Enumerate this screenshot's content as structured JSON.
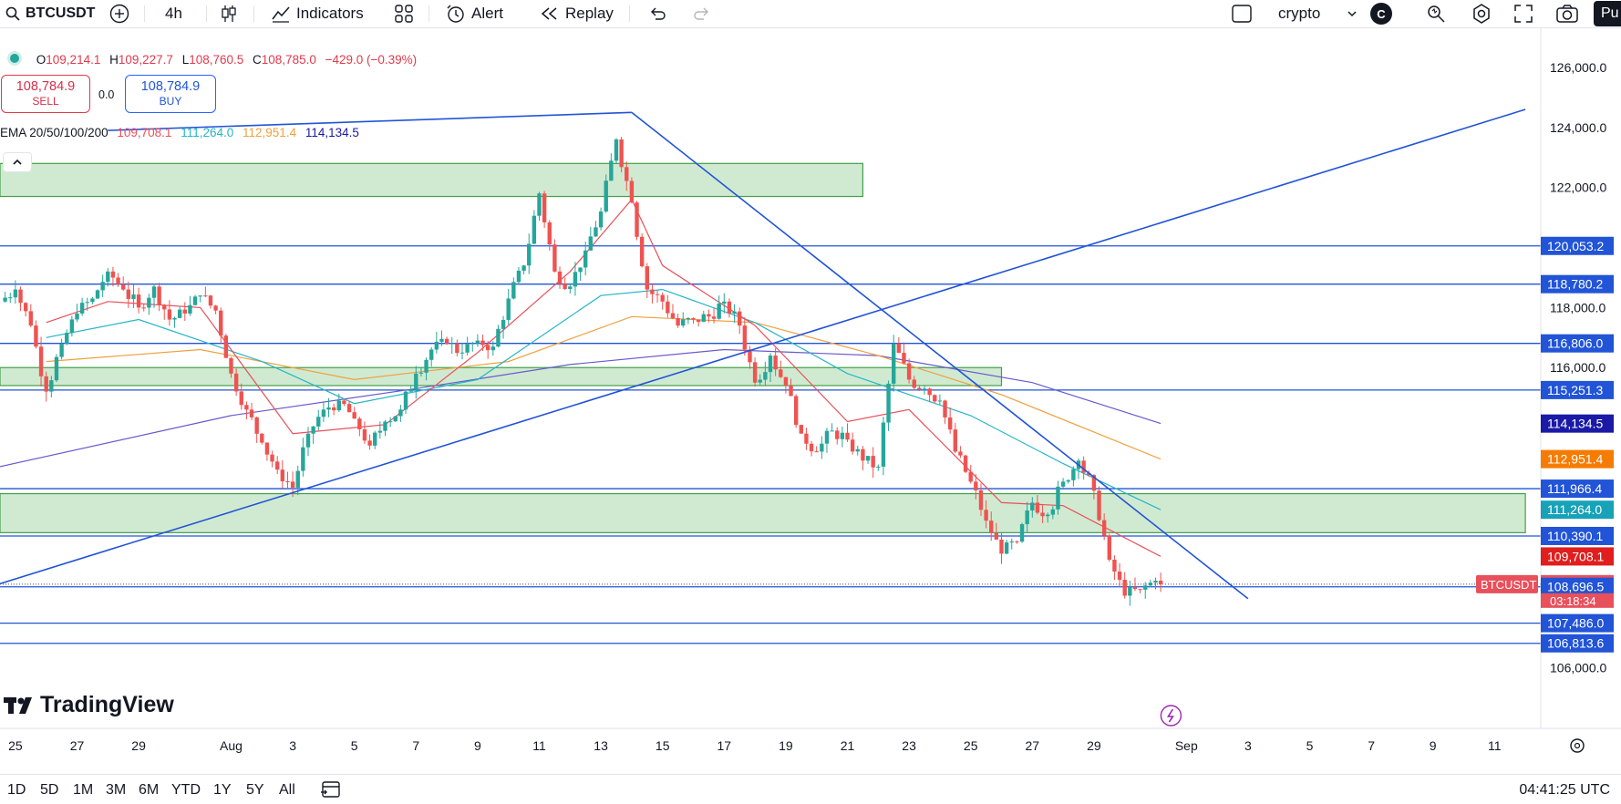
{
  "toolbar": {
    "symbol": "BTCUSDT",
    "interval": "4h",
    "indicators_label": "Indicators",
    "alert_label": "Alert",
    "replay_label": "Replay",
    "layout_name": "crypto",
    "account_initial": "C",
    "publish_label": "Pu"
  },
  "legend": {
    "o_label": "O",
    "o": "109,214.1",
    "h_label": "H",
    "h": "109,227.7",
    "l_label": "L",
    "l": "108,760.5",
    "c_label": "C",
    "c": "108,785.0",
    "change": "−429.0 (−0.39%)"
  },
  "trade": {
    "sell_price": "108,784.9",
    "sell_label": "SELL",
    "spread": "0.0",
    "buy_price": "108,784.9",
    "buy_label": "BUY"
  },
  "ema": {
    "label": "EMA 20/50/100/200",
    "v20": "109,708.1",
    "v50": "111,264.0",
    "v100": "112,951.4",
    "v200": "114,134.5"
  },
  "logo_text": "TradingView",
  "bottom": {
    "ranges": [
      "1D",
      "5D",
      "1M",
      "3M",
      "6M",
      "YTD",
      "1Y",
      "5Y",
      "All"
    ],
    "clock": "04:41:25 UTC"
  },
  "colors": {
    "up": "#26a69a",
    "down": "#ef5350",
    "line_blue": "#2154d6",
    "zone_fill": "#c8e6c9",
    "zone_stroke": "#43a047",
    "ema20": "#e8505b",
    "ema50": "#26b5c8",
    "ema100": "#f0a040",
    "ema200": "#6a5acd"
  },
  "chart_data": {
    "type": "candlestick",
    "symbol": "BTCUSDT",
    "interval": "4h",
    "ylim": [
      105500,
      127000
    ],
    "y_ticks": [
      "126,000.0",
      "124,000.0",
      "122,000.0",
      "118,000.0",
      "116,000.0",
      "106,000.0"
    ],
    "x_ticks": [
      "25",
      "27",
      "29",
      "Aug",
      "3",
      "5",
      "7",
      "9",
      "11",
      "13",
      "15",
      "17",
      "19",
      "21",
      "23",
      "25",
      "27",
      "29",
      "Sep",
      "3",
      "5",
      "7",
      "9",
      "11"
    ],
    "x_tick_dates": [
      "2025-07-25",
      "2025-07-27",
      "2025-07-29",
      "2025-08-01",
      "2025-08-03",
      "2025-08-05",
      "2025-08-07",
      "2025-08-09",
      "2025-08-11",
      "2025-08-13",
      "2025-08-15",
      "2025-08-17",
      "2025-08-19",
      "2025-08-21",
      "2025-08-23",
      "2025-08-25",
      "2025-08-27",
      "2025-08-29",
      "2025-09-01",
      "2025-09-03",
      "2025-09-05",
      "2025-09-07",
      "2025-09-09",
      "2025-09-11"
    ],
    "x_range": [
      "2025-07-24T12:00",
      "2025-09-12T12:00"
    ],
    "close_path": [
      [
        "2025-07-24T12:00",
        118200
      ],
      [
        "2025-07-25T00:00",
        118600
      ],
      [
        "2025-07-25T12:00",
        117400
      ],
      [
        "2025-07-26T00:00",
        115200
      ],
      [
        "2025-07-26T12:00",
        116800
      ],
      [
        "2025-07-27T00:00",
        117800
      ],
      [
        "2025-07-27T12:00",
        118300
      ],
      [
        "2025-07-28T00:00",
        119200
      ],
      [
        "2025-07-28T12:00",
        118600
      ],
      [
        "2025-07-29T00:00",
        118000
      ],
      [
        "2025-07-29T12:00",
        118700
      ],
      [
        "2025-07-30T00:00",
        117600
      ],
      [
        "2025-07-30T12:00",
        117800
      ],
      [
        "2025-07-31T00:00",
        118400
      ],
      [
        "2025-07-31T12:00",
        117900
      ],
      [
        "2025-08-01T00:00",
        115800
      ],
      [
        "2025-08-01T12:00",
        114600
      ],
      [
        "2025-08-02T00:00",
        113500
      ],
      [
        "2025-08-02T12:00",
        112600
      ],
      [
        "2025-08-03T00:00",
        112000
      ],
      [
        "2025-08-03T12:00",
        113800
      ],
      [
        "2025-08-04T00:00",
        114600
      ],
      [
        "2025-08-04T12:00",
        114900
      ],
      [
        "2025-08-05T00:00",
        114300
      ],
      [
        "2025-08-05T12:00",
        113400
      ],
      [
        "2025-08-06T00:00",
        114200
      ],
      [
        "2025-08-06T12:00",
        114600
      ],
      [
        "2025-08-07T00:00",
        115800
      ],
      [
        "2025-08-07T12:00",
        116600
      ],
      [
        "2025-08-08T00:00",
        116800
      ],
      [
        "2025-08-08T12:00",
        116500
      ],
      [
        "2025-08-09T00:00",
        116900
      ],
      [
        "2025-08-09T12:00",
        116700
      ],
      [
        "2025-08-10T00:00",
        118300
      ],
      [
        "2025-08-10T12:00",
        119400
      ],
      [
        "2025-08-11T00:00",
        121800
      ],
      [
        "2025-08-11T12:00",
        119200
      ],
      [
        "2025-08-12T00:00",
        118700
      ],
      [
        "2025-08-12T12:00",
        119900
      ],
      [
        "2025-08-13T00:00",
        121200
      ],
      [
        "2025-08-13T12:00",
        123600
      ],
      [
        "2025-08-14T00:00",
        121500
      ],
      [
        "2025-08-14T12:00",
        118600
      ],
      [
        "2025-08-15T00:00",
        118200
      ],
      [
        "2025-08-15T12:00",
        117400
      ],
      [
        "2025-08-16T00:00",
        117600
      ],
      [
        "2025-08-16T12:00",
        117700
      ],
      [
        "2025-08-17T00:00",
        118200
      ],
      [
        "2025-08-17T12:00",
        117400
      ],
      [
        "2025-08-18T00:00",
        115500
      ],
      [
        "2025-08-18T12:00",
        116400
      ],
      [
        "2025-08-19T00:00",
        115400
      ],
      [
        "2025-08-19T12:00",
        113800
      ],
      [
        "2025-08-20T00:00",
        113200
      ],
      [
        "2025-08-20T12:00",
        113900
      ],
      [
        "2025-08-21T00:00",
        113600
      ],
      [
        "2025-08-21T12:00",
        112900
      ],
      [
        "2025-08-22T00:00",
        112700
      ],
      [
        "2025-08-22T12:00",
        116800
      ],
      [
        "2025-08-23T00:00",
        115600
      ],
      [
        "2025-08-23T12:00",
        115300
      ],
      [
        "2025-08-24T00:00",
        114900
      ],
      [
        "2025-08-24T12:00",
        113200
      ],
      [
        "2025-08-25T00:00",
        112200
      ],
      [
        "2025-08-25T12:00",
        110900
      ],
      [
        "2025-08-26T00:00",
        109800
      ],
      [
        "2025-08-26T12:00",
        110200
      ],
      [
        "2025-08-27T00:00",
        111500
      ],
      [
        "2025-08-27T12:00",
        111100
      ],
      [
        "2025-08-28T00:00",
        112200
      ],
      [
        "2025-08-28T12:00",
        112900
      ],
      [
        "2025-08-29T00:00",
        111900
      ],
      [
        "2025-08-29T12:00",
        109600
      ],
      [
        "2025-08-30T00:00",
        108400
      ],
      [
        "2025-08-30T12:00",
        108600
      ],
      [
        "2025-08-31T00:00",
        108900
      ],
      [
        "2025-08-31T04:00",
        108785
      ]
    ],
    "last_close": 108785.0,
    "horizontal_levels": [
      120053.2,
      118780.2,
      116806.0,
      115251.3,
      111966.4,
      110390.1,
      108696.5,
      107486.0,
      106813.6
    ],
    "zones": [
      {
        "x1": "2025-07-24T12:00",
        "x2": "2025-08-21T12:00",
        "y1": 121700,
        "y2": 122800
      },
      {
        "x1": "2025-07-24T12:00",
        "x2": "2025-08-26T00:00",
        "y1": 115400,
        "y2": 116000
      },
      {
        "x1": "2025-07-24T12:00",
        "x2": "2025-09-12T00:00",
        "y1": 110500,
        "y2": 111800
      }
    ],
    "trendlines": [
      {
        "x1": "2025-07-24T12:00",
        "y1": 108800,
        "x2": "2025-09-12T00:00",
        "y2": 124600
      },
      {
        "x1": "2025-08-14T00:00",
        "y1": 124500,
        "x2": "2025-09-03T00:00",
        "y2": 108300
      },
      {
        "x1": "2025-07-28T00:00",
        "y1": 123900,
        "x2": "2025-08-14T00:00",
        "y2": 124500
      }
    ],
    "ema_points": {
      "ema20": [
        [
          "2025-07-26T00:00",
          117500
        ],
        [
          "2025-07-28T00:00",
          118200
        ],
        [
          "2025-07-31T00:00",
          118000
        ],
        [
          "2025-08-03T00:00",
          113800
        ],
        [
          "2025-08-06T00:00",
          114100
        ],
        [
          "2025-08-09T00:00",
          116500
        ],
        [
          "2025-08-12T00:00",
          119200
        ],
        [
          "2025-08-14T00:00",
          121600
        ],
        [
          "2025-08-15T00:00",
          119400
        ],
        [
          "2025-08-18T00:00",
          117400
        ],
        [
          "2025-08-21T00:00",
          114200
        ],
        [
          "2025-08-23T00:00",
          114600
        ],
        [
          "2025-08-26T00:00",
          111500
        ],
        [
          "2025-08-28T00:00",
          111400
        ],
        [
          "2025-08-31T04:00",
          109708
        ]
      ],
      "ema50": [
        [
          "2025-07-26T00:00",
          117000
        ],
        [
          "2025-07-29T00:00",
          117600
        ],
        [
          "2025-08-02T00:00",
          116200
        ],
        [
          "2025-08-05T00:00",
          114800
        ],
        [
          "2025-08-09T00:00",
          115600
        ],
        [
          "2025-08-13T00:00",
          118400
        ],
        [
          "2025-08-15T00:00",
          118600
        ],
        [
          "2025-08-18T00:00",
          117500
        ],
        [
          "2025-08-21T00:00",
          115800
        ],
        [
          "2025-08-25T00:00",
          114400
        ],
        [
          "2025-08-28T00:00",
          112800
        ],
        [
          "2025-08-31T04:00",
          111264
        ]
      ],
      "ema100": [
        [
          "2025-07-26T00:00",
          116200
        ],
        [
          "2025-07-31T00:00",
          116600
        ],
        [
          "2025-08-05T00:00",
          115600
        ],
        [
          "2025-08-10T00:00",
          116200
        ],
        [
          "2025-08-14T00:00",
          117700
        ],
        [
          "2025-08-18T00:00",
          117500
        ],
        [
          "2025-08-22T00:00",
          116400
        ],
        [
          "2025-08-26T00:00",
          115100
        ],
        [
          "2025-08-31T04:00",
          112951
        ]
      ],
      "ema200": [
        [
          "2025-07-24T12:00",
          112700
        ],
        [
          "2025-08-01T00:00",
          114400
        ],
        [
          "2025-08-07T00:00",
          115300
        ],
        [
          "2025-08-12T00:00",
          116100
        ],
        [
          "2025-08-17T00:00",
          116600
        ],
        [
          "2025-08-22T00:00",
          116400
        ],
        [
          "2025-08-27T00:00",
          115500
        ],
        [
          "2025-08-31T04:00",
          114135
        ]
      ]
    },
    "axis_labels": [
      {
        "text": "120,053.2",
        "y": 120053.2,
        "bg": "#2154d6"
      },
      {
        "text": "118,780.2",
        "y": 118780.2,
        "bg": "#2154d6"
      },
      {
        "text": "116,806.0",
        "y": 116806.0,
        "bg": "#2154d6"
      },
      {
        "text": "115,251.3",
        "y": 115251.3,
        "bg": "#2154d6"
      },
      {
        "text": "114,134.5",
        "y": 114134.5,
        "bg": "#1a1aa6"
      },
      {
        "text": "112,951.4",
        "y": 112951.4,
        "bg": "#f57c00"
      },
      {
        "text": "111,966.4",
        "y": 111966.4,
        "bg": "#2154d6"
      },
      {
        "text": "111,264.0",
        "y": 111264.0,
        "bg": "#17a2b8"
      },
      {
        "text": "110,390.1",
        "y": 110390.1,
        "bg": "#2154d6"
      },
      {
        "text": "109,708.1",
        "y": 109708.1,
        "bg": "#e01e1e"
      },
      {
        "text": "108,785.0",
        "y": 108785.0,
        "bg": "#e8505b"
      },
      {
        "text": "108,696.5",
        "y": 108696.5,
        "bg": "#2154d6"
      },
      {
        "text": "107,486.0",
        "y": 107486.0,
        "bg": "#2154d6"
      },
      {
        "text": "106,813.6",
        "y": 106813.6,
        "bg": "#2154d6"
      }
    ],
    "countdown": "03:18:34",
    "symbol_tag": "BTCUSDT"
  }
}
